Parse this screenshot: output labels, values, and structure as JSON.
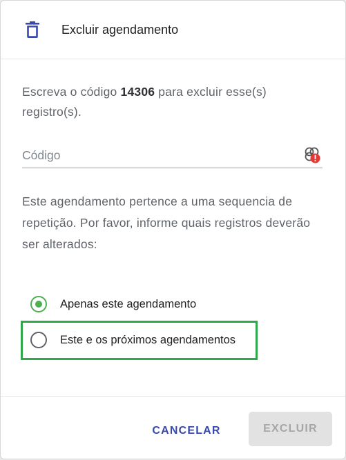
{
  "dialog": {
    "title": "Excluir agendamento",
    "title_icon": "trash-icon",
    "accent_color": "#3949ab",
    "success_color": "#4caf50"
  },
  "instruction": {
    "prefix": "Escreva o código ",
    "code": "14306",
    "suffix": " para excluir esse(s) registro(s)."
  },
  "code_field": {
    "placeholder": "Código",
    "value": "",
    "icon": "extension-warning-icon"
  },
  "sequence_message": "Este agendamento pertence a uma sequencia de repetição. Por favor, informe quais registros deverão ser alterados:",
  "options": [
    {
      "label": "Apenas este agendamento",
      "selected": true
    },
    {
      "label": "Este e os próximos agendamentos",
      "selected": false
    }
  ],
  "actions": {
    "cancel_label": "CANCELAR",
    "delete_label": "EXCLUIR",
    "delete_disabled": true
  }
}
